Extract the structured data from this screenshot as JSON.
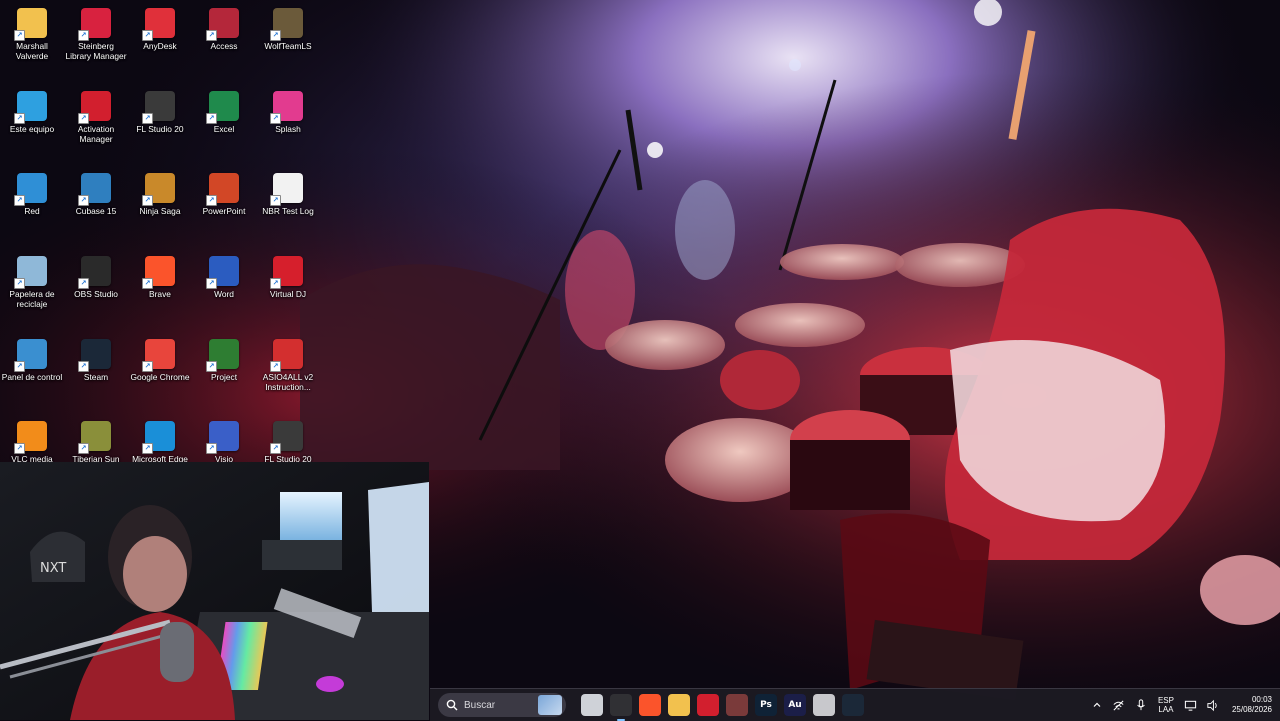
{
  "desktop": {
    "icons": [
      {
        "label": "Marshall Valverde",
        "icon": "folder-icon",
        "color": "#f2c14e"
      },
      {
        "label": "Steinberg Library Manager",
        "icon": "steinberg-library-icon",
        "color": "#d8223f"
      },
      {
        "label": "AnyDesk",
        "icon": "anydesk-icon",
        "color": "#e0303a"
      },
      {
        "label": "Access",
        "icon": "access-icon",
        "color": "#b4273a"
      },
      {
        "label": "WolfTeamLS",
        "icon": "wolfteam-icon",
        "color": "#6b5a3a"
      },
      {
        "label": "Este equipo",
        "icon": "this-pc-icon",
        "color": "#2ea0e0"
      },
      {
        "label": "Activation Manager",
        "icon": "activation-manager-icon",
        "color": "#d21f2e"
      },
      {
        "label": "FL Studio 20",
        "icon": "fl-studio-icon",
        "color": "#3a3a3a"
      },
      {
        "label": "Excel",
        "icon": "excel-icon",
        "color": "#1f8a4c"
      },
      {
        "label": "Splash",
        "icon": "splash-icon",
        "color": "#e23b8f"
      },
      {
        "label": "Red",
        "icon": "network-icon",
        "color": "#2f8fd6"
      },
      {
        "label": "Cubase 15",
        "icon": "cubase-icon",
        "color": "#2f7fbf"
      },
      {
        "label": "Ninja Saga",
        "icon": "ninja-saga-icon",
        "color": "#c9892a"
      },
      {
        "label": "PowerPoint",
        "icon": "powerpoint-icon",
        "color": "#d24726"
      },
      {
        "label": "NBR Test Log",
        "icon": "text-file-icon",
        "color": "#f2f2f2"
      },
      {
        "label": "Papelera de reciclaje",
        "icon": "recycle-bin-icon",
        "color": "#8fb8d8"
      },
      {
        "label": "OBS Studio",
        "icon": "obs-icon",
        "color": "#2a2a2a"
      },
      {
        "label": "Brave",
        "icon": "brave-icon",
        "color": "#fb542b"
      },
      {
        "label": "Word",
        "icon": "word-icon",
        "color": "#2b5cc0"
      },
      {
        "label": "Virtual DJ",
        "icon": "virtual-dj-icon",
        "color": "#d61f2c"
      },
      {
        "label": "Panel de control",
        "icon": "control-panel-icon",
        "color": "#3a8fd0"
      },
      {
        "label": "Steam",
        "icon": "steam-icon",
        "color": "#1b2838"
      },
      {
        "label": "Google Chrome",
        "icon": "chrome-icon",
        "color": "#e8453c"
      },
      {
        "label": "Project",
        "icon": "project-icon",
        "color": "#2e7d32"
      },
      {
        "label": "ASIO4ALL v2 Instruction...",
        "icon": "pdf-icon",
        "color": "#d32f2f"
      },
      {
        "label": "VLC media player",
        "icon": "vlc-icon",
        "color": "#f28c1a"
      },
      {
        "label": "Tiberian Sun",
        "icon": "tiberian-sun-icon",
        "color": "#8a8f3a"
      },
      {
        "label": "Microsoft Edge",
        "icon": "edge-icon",
        "color": "#1a8fd8"
      },
      {
        "label": "Visio",
        "icon": "visio-icon",
        "color": "#3a5fc8"
      },
      {
        "label": "FL Studio 20",
        "icon": "fl-studio-icon",
        "color": "#3a3a3a"
      }
    ]
  },
  "taskbar": {
    "search_placeholder": "Buscar",
    "apps": [
      {
        "name": "task-view",
        "glyph": "",
        "color": "#cfd2d8"
      },
      {
        "name": "obs",
        "glyph": "",
        "color": "#303034",
        "active": true
      },
      {
        "name": "brave",
        "glyph": "",
        "color": "#fb542b"
      },
      {
        "name": "file-explorer",
        "glyph": "",
        "color": "#f2c14e"
      },
      {
        "name": "activation-manager",
        "glyph": "",
        "color": "#d21f2e"
      },
      {
        "name": "winrar",
        "glyph": "",
        "color": "#7a3a3a"
      },
      {
        "name": "photoshop",
        "glyph": "Ps",
        "color": "#0f2236"
      },
      {
        "name": "audition",
        "glyph": "Au",
        "color": "#1b1e48"
      },
      {
        "name": "blank-window",
        "glyph": "",
        "color": "#c8c8cc"
      },
      {
        "name": "steam",
        "glyph": "",
        "color": "#1b2838"
      }
    ],
    "language": {
      "line1": "ESP",
      "line2": "LAA"
    },
    "time": "00:03",
    "date": "25/08/2026"
  }
}
